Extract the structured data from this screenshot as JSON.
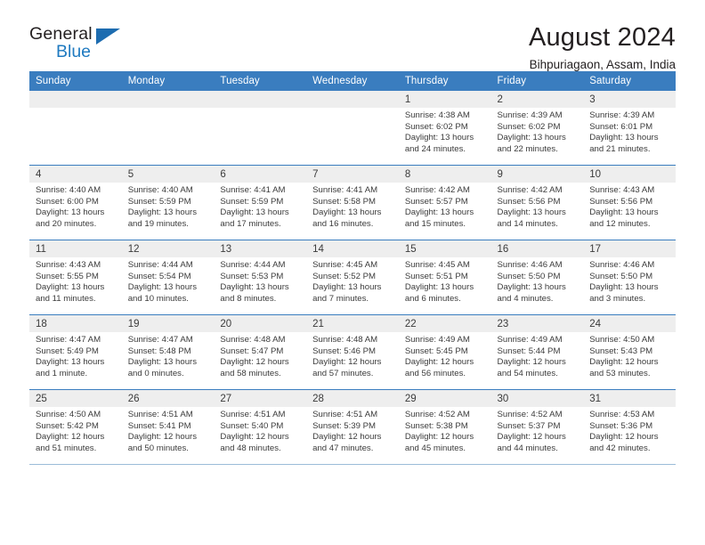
{
  "logo": {
    "line1": "General",
    "line2": "Blue",
    "accent_color": "#1f7ac0",
    "triangle_icon": "triangle-icon"
  },
  "header": {
    "title": "August 2024",
    "subtitle": "Bihpuriagaon, Assam, India"
  },
  "theme": {
    "header_bg": "#3a7dbf",
    "daynum_bg": "#eeeeee",
    "text": "#3b3b3b",
    "grid_line": "#3a7dbf"
  },
  "calendar": {
    "weekday_headers": [
      "Sunday",
      "Monday",
      "Tuesday",
      "Wednesday",
      "Thursday",
      "Friday",
      "Saturday"
    ],
    "labels": {
      "sunrise": "Sunrise:",
      "sunset": "Sunset:",
      "daylight": "Daylight:"
    },
    "weeks": [
      [
        {
          "day": ""
        },
        {
          "day": ""
        },
        {
          "day": ""
        },
        {
          "day": ""
        },
        {
          "day": "1",
          "sunrise": "Sunrise: 4:38 AM",
          "sunset": "Sunset: 6:02 PM",
          "daylight_l1": "Daylight: 13 hours",
          "daylight_l2": "and 24 minutes."
        },
        {
          "day": "2",
          "sunrise": "Sunrise: 4:39 AM",
          "sunset": "Sunset: 6:02 PM",
          "daylight_l1": "Daylight: 13 hours",
          "daylight_l2": "and 22 minutes."
        },
        {
          "day": "3",
          "sunrise": "Sunrise: 4:39 AM",
          "sunset": "Sunset: 6:01 PM",
          "daylight_l1": "Daylight: 13 hours",
          "daylight_l2": "and 21 minutes."
        }
      ],
      [
        {
          "day": "4",
          "sunrise": "Sunrise: 4:40 AM",
          "sunset": "Sunset: 6:00 PM",
          "daylight_l1": "Daylight: 13 hours",
          "daylight_l2": "and 20 minutes."
        },
        {
          "day": "5",
          "sunrise": "Sunrise: 4:40 AM",
          "sunset": "Sunset: 5:59 PM",
          "daylight_l1": "Daylight: 13 hours",
          "daylight_l2": "and 19 minutes."
        },
        {
          "day": "6",
          "sunrise": "Sunrise: 4:41 AM",
          "sunset": "Sunset: 5:59 PM",
          "daylight_l1": "Daylight: 13 hours",
          "daylight_l2": "and 17 minutes."
        },
        {
          "day": "7",
          "sunrise": "Sunrise: 4:41 AM",
          "sunset": "Sunset: 5:58 PM",
          "daylight_l1": "Daylight: 13 hours",
          "daylight_l2": "and 16 minutes."
        },
        {
          "day": "8",
          "sunrise": "Sunrise: 4:42 AM",
          "sunset": "Sunset: 5:57 PM",
          "daylight_l1": "Daylight: 13 hours",
          "daylight_l2": "and 15 minutes."
        },
        {
          "day": "9",
          "sunrise": "Sunrise: 4:42 AM",
          "sunset": "Sunset: 5:56 PM",
          "daylight_l1": "Daylight: 13 hours",
          "daylight_l2": "and 14 minutes."
        },
        {
          "day": "10",
          "sunrise": "Sunrise: 4:43 AM",
          "sunset": "Sunset: 5:56 PM",
          "daylight_l1": "Daylight: 13 hours",
          "daylight_l2": "and 12 minutes."
        }
      ],
      [
        {
          "day": "11",
          "sunrise": "Sunrise: 4:43 AM",
          "sunset": "Sunset: 5:55 PM",
          "daylight_l1": "Daylight: 13 hours",
          "daylight_l2": "and 11 minutes."
        },
        {
          "day": "12",
          "sunrise": "Sunrise: 4:44 AM",
          "sunset": "Sunset: 5:54 PM",
          "daylight_l1": "Daylight: 13 hours",
          "daylight_l2": "and 10 minutes."
        },
        {
          "day": "13",
          "sunrise": "Sunrise: 4:44 AM",
          "sunset": "Sunset: 5:53 PM",
          "daylight_l1": "Daylight: 13 hours",
          "daylight_l2": "and 8 minutes."
        },
        {
          "day": "14",
          "sunrise": "Sunrise: 4:45 AM",
          "sunset": "Sunset: 5:52 PM",
          "daylight_l1": "Daylight: 13 hours",
          "daylight_l2": "and 7 minutes."
        },
        {
          "day": "15",
          "sunrise": "Sunrise: 4:45 AM",
          "sunset": "Sunset: 5:51 PM",
          "daylight_l1": "Daylight: 13 hours",
          "daylight_l2": "and 6 minutes."
        },
        {
          "day": "16",
          "sunrise": "Sunrise: 4:46 AM",
          "sunset": "Sunset: 5:50 PM",
          "daylight_l1": "Daylight: 13 hours",
          "daylight_l2": "and 4 minutes."
        },
        {
          "day": "17",
          "sunrise": "Sunrise: 4:46 AM",
          "sunset": "Sunset: 5:50 PM",
          "daylight_l1": "Daylight: 13 hours",
          "daylight_l2": "and 3 minutes."
        }
      ],
      [
        {
          "day": "18",
          "sunrise": "Sunrise: 4:47 AM",
          "sunset": "Sunset: 5:49 PM",
          "daylight_l1": "Daylight: 13 hours",
          "daylight_l2": "and 1 minute."
        },
        {
          "day": "19",
          "sunrise": "Sunrise: 4:47 AM",
          "sunset": "Sunset: 5:48 PM",
          "daylight_l1": "Daylight: 13 hours",
          "daylight_l2": "and 0 minutes."
        },
        {
          "day": "20",
          "sunrise": "Sunrise: 4:48 AM",
          "sunset": "Sunset: 5:47 PM",
          "daylight_l1": "Daylight: 12 hours",
          "daylight_l2": "and 58 minutes."
        },
        {
          "day": "21",
          "sunrise": "Sunrise: 4:48 AM",
          "sunset": "Sunset: 5:46 PM",
          "daylight_l1": "Daylight: 12 hours",
          "daylight_l2": "and 57 minutes."
        },
        {
          "day": "22",
          "sunrise": "Sunrise: 4:49 AM",
          "sunset": "Sunset: 5:45 PM",
          "daylight_l1": "Daylight: 12 hours",
          "daylight_l2": "and 56 minutes."
        },
        {
          "day": "23",
          "sunrise": "Sunrise: 4:49 AM",
          "sunset": "Sunset: 5:44 PM",
          "daylight_l1": "Daylight: 12 hours",
          "daylight_l2": "and 54 minutes."
        },
        {
          "day": "24",
          "sunrise": "Sunrise: 4:50 AM",
          "sunset": "Sunset: 5:43 PM",
          "daylight_l1": "Daylight: 12 hours",
          "daylight_l2": "and 53 minutes."
        }
      ],
      [
        {
          "day": "25",
          "sunrise": "Sunrise: 4:50 AM",
          "sunset": "Sunset: 5:42 PM",
          "daylight_l1": "Daylight: 12 hours",
          "daylight_l2": "and 51 minutes."
        },
        {
          "day": "26",
          "sunrise": "Sunrise: 4:51 AM",
          "sunset": "Sunset: 5:41 PM",
          "daylight_l1": "Daylight: 12 hours",
          "daylight_l2": "and 50 minutes."
        },
        {
          "day": "27",
          "sunrise": "Sunrise: 4:51 AM",
          "sunset": "Sunset: 5:40 PM",
          "daylight_l1": "Daylight: 12 hours",
          "daylight_l2": "and 48 minutes."
        },
        {
          "day": "28",
          "sunrise": "Sunrise: 4:51 AM",
          "sunset": "Sunset: 5:39 PM",
          "daylight_l1": "Daylight: 12 hours",
          "daylight_l2": "and 47 minutes."
        },
        {
          "day": "29",
          "sunrise": "Sunrise: 4:52 AM",
          "sunset": "Sunset: 5:38 PM",
          "daylight_l1": "Daylight: 12 hours",
          "daylight_l2": "and 45 minutes."
        },
        {
          "day": "30",
          "sunrise": "Sunrise: 4:52 AM",
          "sunset": "Sunset: 5:37 PM",
          "daylight_l1": "Daylight: 12 hours",
          "daylight_l2": "and 44 minutes."
        },
        {
          "day": "31",
          "sunrise": "Sunrise: 4:53 AM",
          "sunset": "Sunset: 5:36 PM",
          "daylight_l1": "Daylight: 12 hours",
          "daylight_l2": "and 42 minutes."
        }
      ]
    ]
  }
}
